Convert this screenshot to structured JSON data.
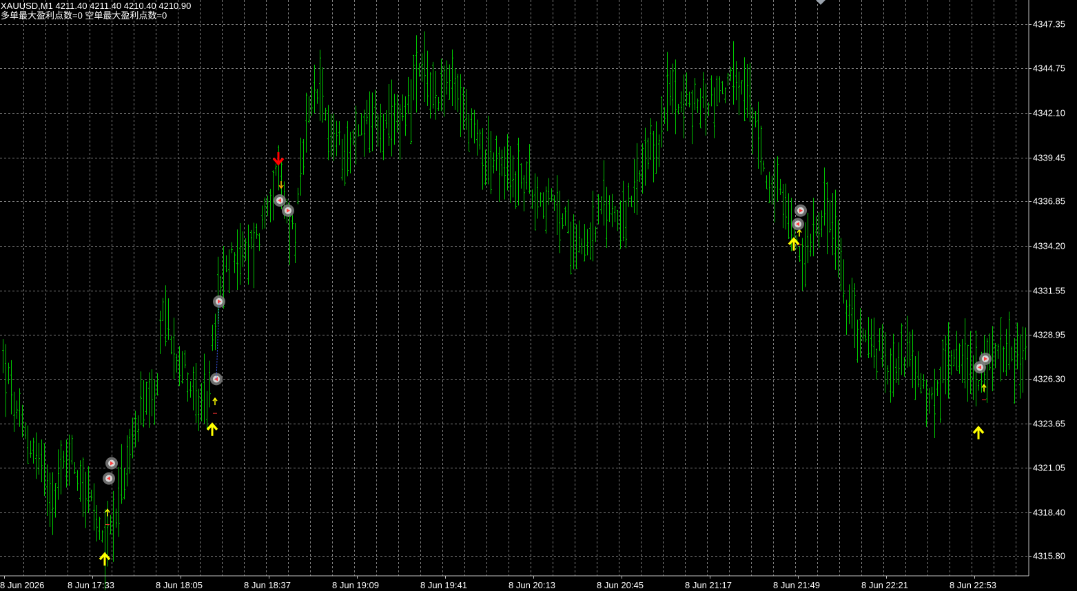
{
  "header": {
    "symbol_line": "XAUUSD,M1  4211.40 4211.40 4210.40 4210.90",
    "stats_line": "多单最大盈利点数=0  空单最大盈利点数=0"
  },
  "colors": {
    "background": "#000000",
    "grid": "#7f7f7f",
    "bars": "#00c800",
    "axis": "#c0c0c0",
    "text": "#ffffff",
    "buy_arrow": "#ffff00",
    "buy_arrow_edge": "#32cd32",
    "sell_arrow": "#ff0000",
    "small_arrow": "#ffa500",
    "marker_ring": "#a0a0a0",
    "marker_exit": "#ff4040"
  },
  "chart_data": {
    "type": "bar",
    "subtype": "ohlc",
    "grid": true,
    "y_axis_side": "right",
    "ylim": [
      4314.62,
      4348.8
    ],
    "y_ticks": [
      "4347.35",
      "4344.75",
      "4342.10",
      "4339.45",
      "4336.85",
      "4334.20",
      "4331.55",
      "4328.95",
      "4326.30",
      "4323.65",
      "4321.05",
      "4318.40",
      "4315.80"
    ],
    "x_ticks": [
      "8 Jun 2026",
      "8 Jun 17:33",
      "8 Jun 18:05",
      "8 Jun 18:37",
      "8 Jun 19:09",
      "8 Jun 19:41",
      "8 Jun 20:13",
      "8 Jun 20:45",
      "8 Jun 21:17",
      "8 Jun 21:49",
      "8 Jun 22:21",
      "8 Jun 22:53"
    ],
    "bar_count": 372,
    "minutes_per_bar": 1,
    "price_path": [
      [
        0,
        4327.5
      ],
      [
        5,
        4324.0
      ],
      [
        12,
        4321.8
      ],
      [
        18,
        4319.5
      ],
      [
        24,
        4322.0
      ],
      [
        32,
        4319.0
      ],
      [
        36,
        4316.2
      ],
      [
        40,
        4318.0
      ],
      [
        44,
        4320.5
      ],
      [
        50,
        4324.5
      ],
      [
        55,
        4324.5
      ],
      [
        58,
        4330.5
      ],
      [
        62,
        4328.5
      ],
      [
        67,
        4326.5
      ],
      [
        72,
        4324.2
      ],
      [
        74,
        4325.0
      ],
      [
        78,
        4331.0
      ],
      [
        84,
        4334.0
      ],
      [
        88,
        4333.5
      ],
      [
        93,
        4335.0
      ],
      [
        97,
        4337.5
      ],
      [
        100,
        4338.2
      ],
      [
        104,
        4335.5
      ],
      [
        106,
        4335.0
      ],
      [
        110,
        4341.0
      ],
      [
        114,
        4343.5
      ],
      [
        120,
        4340.5
      ],
      [
        126,
        4340.0
      ],
      [
        132,
        4342.0
      ],
      [
        140,
        4341.0
      ],
      [
        146,
        4342.5
      ],
      [
        152,
        4344.5
      ],
      [
        157,
        4343.0
      ],
      [
        160,
        4344.0
      ],
      [
        166,
        4342.8
      ],
      [
        170,
        4341.0
      ],
      [
        176,
        4339.5
      ],
      [
        182,
        4338.5
      ],
      [
        190,
        4338.0
      ],
      [
        200,
        4336.5
      ],
      [
        206,
        4335.0
      ],
      [
        212,
        4334.5
      ],
      [
        218,
        4336.5
      ],
      [
        226,
        4336.0
      ],
      [
        232,
        4338.5
      ],
      [
        238,
        4340.5
      ],
      [
        242,
        4343.5
      ],
      [
        250,
        4342.5
      ],
      [
        258,
        4343.0
      ],
      [
        264,
        4344.0
      ],
      [
        270,
        4343.0
      ],
      [
        274,
        4340.5
      ],
      [
        278,
        4338.0
      ],
      [
        282,
        4337.0
      ],
      [
        286,
        4335.0
      ],
      [
        290,
        4333.5
      ],
      [
        294,
        4335.5
      ],
      [
        298,
        4336.5
      ],
      [
        302,
        4335.0
      ],
      [
        306,
        4330.5
      ],
      [
        310,
        4329.5
      ],
      [
        314,
        4328.5
      ],
      [
        318,
        4327.8
      ],
      [
        322,
        4327.2
      ],
      [
        328,
        4328.0
      ],
      [
        334,
        4325.5
      ],
      [
        338,
        4325.0
      ],
      [
        342,
        4327.0
      ],
      [
        346,
        4328.5
      ],
      [
        350,
        4327.0
      ],
      [
        356,
        4326.5
      ],
      [
        362,
        4328.5
      ],
      [
        366,
        4327.5
      ],
      [
        371,
        4328.0
      ]
    ],
    "signals": [
      {
        "type": "buy",
        "time": "8 Jun 17:33",
        "bar": 37,
        "price": 4315.8
      },
      {
        "type": "buy",
        "time": "8 Jun 18:05",
        "bar": 76,
        "price": 4323.5
      },
      {
        "type": "sell",
        "time": "8 Jun 18:37",
        "bar": 100,
        "price": 4339.2
      },
      {
        "type": "buy",
        "time": "8 Jun 21:49",
        "bar": 287,
        "price": 4334.5
      },
      {
        "type": "buy",
        "time": "8 Jun 22:53",
        "bar": 354,
        "price": 4323.3
      }
    ],
    "trade_markers": [
      {
        "bar": 38,
        "price": 4320.4,
        "kind": "entry"
      },
      {
        "bar": 39,
        "price": 4321.3,
        "kind": "exit"
      },
      {
        "bar": 77,
        "price": 4326.3,
        "kind": "entry"
      },
      {
        "bar": 78,
        "price": 4330.9,
        "kind": "exit"
      },
      {
        "bar": 100,
        "price": 4336.9,
        "kind": "entry"
      },
      {
        "bar": 103,
        "price": 4336.3,
        "kind": "exit"
      },
      {
        "bar": 288,
        "price": 4335.5,
        "kind": "entry"
      },
      {
        "bar": 289,
        "price": 4336.3,
        "kind": "exit"
      },
      {
        "bar": 354,
        "price": 4327.0,
        "kind": "entry"
      },
      {
        "bar": 356,
        "price": 4327.5,
        "kind": "exit"
      }
    ],
    "small_arrows": [
      {
        "bar": 38,
        "price": 4318.4,
        "dir": "up"
      },
      {
        "bar": 77,
        "price": 4325.0,
        "dir": "up"
      },
      {
        "bar": 101,
        "price": 4337.8,
        "dir": "down"
      },
      {
        "bar": 289,
        "price": 4335.0,
        "dir": "up"
      },
      {
        "bar": 356,
        "price": 4325.8,
        "dir": "up"
      }
    ]
  }
}
